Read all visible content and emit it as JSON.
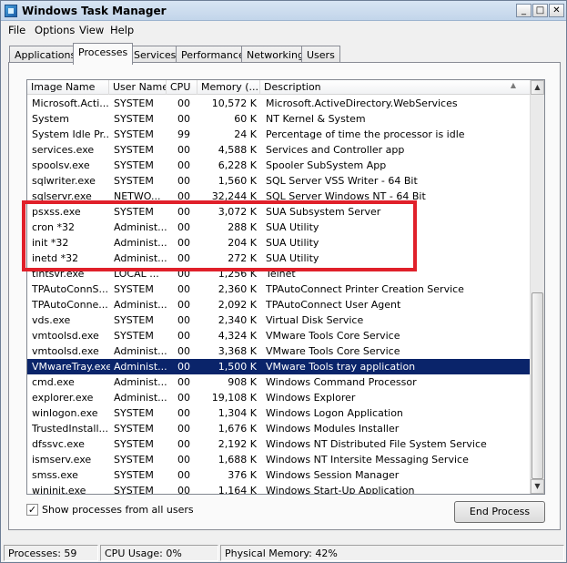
{
  "window": {
    "title": "Windows Task Manager",
    "controls": {
      "minimize": "_",
      "restore": "□",
      "close": "✕"
    }
  },
  "menu": [
    "File",
    "Options",
    "View",
    "Help"
  ],
  "tabs": [
    "Applications",
    "Processes",
    "Services",
    "Performance",
    "Networking",
    "Users"
  ],
  "active_tab": "Processes",
  "table": {
    "columns": [
      "Image Name",
      "User Name",
      "CPU",
      "Memory (...",
      "Description"
    ],
    "sorted_column": "Description",
    "rows": [
      {
        "name": "Microsoft.Acti...",
        "user": "SYSTEM",
        "cpu": "00",
        "mem": "10,572 K",
        "desc": "Microsoft.ActiveDirectory.WebServices"
      },
      {
        "name": "System",
        "user": "SYSTEM",
        "cpu": "00",
        "mem": "60 K",
        "desc": "NT Kernel & System"
      },
      {
        "name": "System Idle Pr...",
        "user": "SYSTEM",
        "cpu": "99",
        "mem": "24 K",
        "desc": "Percentage of time the processor is idle"
      },
      {
        "name": "services.exe",
        "user": "SYSTEM",
        "cpu": "00",
        "mem": "4,588 K",
        "desc": "Services and Controller app"
      },
      {
        "name": "spoolsv.exe",
        "user": "SYSTEM",
        "cpu": "00",
        "mem": "6,228 K",
        "desc": "Spooler SubSystem App"
      },
      {
        "name": "sqlwriter.exe",
        "user": "SYSTEM",
        "cpu": "00",
        "mem": "1,560 K",
        "desc": "SQL Server VSS Writer - 64 Bit"
      },
      {
        "name": "sqlservr.exe",
        "user": "NETWO...",
        "cpu": "00",
        "mem": "32,244 K",
        "desc": "SQL Server Windows NT - 64 Bit"
      },
      {
        "name": "psxss.exe",
        "user": "SYSTEM",
        "cpu": "00",
        "mem": "3,072 K",
        "desc": "SUA Subsystem Server"
      },
      {
        "name": "cron *32",
        "user": "Administ...",
        "cpu": "00",
        "mem": "288 K",
        "desc": "SUA Utility"
      },
      {
        "name": "init *32",
        "user": "Administ...",
        "cpu": "00",
        "mem": "204 K",
        "desc": "SUA Utility"
      },
      {
        "name": "inetd *32",
        "user": "Administ...",
        "cpu": "00",
        "mem": "272 K",
        "desc": "SUA Utility"
      },
      {
        "name": "tlntsvr.exe",
        "user": "LOCAL ...",
        "cpu": "00",
        "mem": "1,256 K",
        "desc": "Telnet"
      },
      {
        "name": "TPAutoConnS...",
        "user": "SYSTEM",
        "cpu": "00",
        "mem": "2,360 K",
        "desc": "TPAutoConnect Printer Creation Service"
      },
      {
        "name": "TPAutoConne...",
        "user": "Administ...",
        "cpu": "00",
        "mem": "2,092 K",
        "desc": "TPAutoConnect User Agent"
      },
      {
        "name": "vds.exe",
        "user": "SYSTEM",
        "cpu": "00",
        "mem": "2,340 K",
        "desc": "Virtual Disk Service"
      },
      {
        "name": "vmtoolsd.exe",
        "user": "SYSTEM",
        "cpu": "00",
        "mem": "4,324 K",
        "desc": "VMware Tools Core Service"
      },
      {
        "name": "vmtoolsd.exe",
        "user": "Administ...",
        "cpu": "00",
        "mem": "3,368 K",
        "desc": "VMware Tools Core Service"
      },
      {
        "name": "VMwareTray.exe",
        "user": "Administ...",
        "cpu": "00",
        "mem": "1,500 K",
        "desc": "VMware Tools tray application",
        "selected": true
      },
      {
        "name": "cmd.exe",
        "user": "Administ...",
        "cpu": "00",
        "mem": "908 K",
        "desc": "Windows Command Processor"
      },
      {
        "name": "explorer.exe",
        "user": "Administ...",
        "cpu": "00",
        "mem": "19,108 K",
        "desc": "Windows Explorer"
      },
      {
        "name": "winlogon.exe",
        "user": "SYSTEM",
        "cpu": "00",
        "mem": "1,304 K",
        "desc": "Windows Logon Application"
      },
      {
        "name": "TrustedInstall...",
        "user": "SYSTEM",
        "cpu": "00",
        "mem": "1,676 K",
        "desc": "Windows Modules Installer"
      },
      {
        "name": "dfssvc.exe",
        "user": "SYSTEM",
        "cpu": "00",
        "mem": "2,192 K",
        "desc": "Windows NT Distributed File System Service"
      },
      {
        "name": "ismserv.exe",
        "user": "SYSTEM",
        "cpu": "00",
        "mem": "1,688 K",
        "desc": "Windows NT Intersite Messaging Service"
      },
      {
        "name": "smss.exe",
        "user": "SYSTEM",
        "cpu": "00",
        "mem": "376 K",
        "desc": "Windows Session Manager"
      },
      {
        "name": "wininit.exe",
        "user": "SYSTEM",
        "cpu": "00",
        "mem": "1,164 K",
        "desc": "Windows Start-Up Application"
      }
    ]
  },
  "show_all_users": {
    "label": "Show processes from all users",
    "checked": true,
    "mark": "✓"
  },
  "end_process_label": "End Process",
  "status": {
    "processes": "Processes: 59",
    "cpu": "CPU Usage: 0%",
    "memory": "Physical Memory: 42%"
  },
  "colors": {
    "selection": "#0a246a",
    "highlight_box": "#e0202a"
  }
}
